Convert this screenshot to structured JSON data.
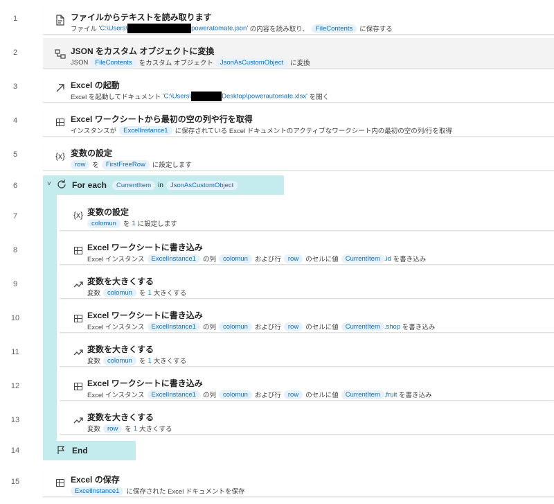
{
  "line_numbers": [
    "1",
    "2",
    "3",
    "4",
    "5",
    "6",
    "7",
    "8",
    "9",
    "10",
    "11",
    "12",
    "13",
    "14",
    "15"
  ],
  "steps": {
    "s1": {
      "icon": "file-read-icon",
      "title": "ファイルからテキストを読み取ります",
      "prefix": "ファイル",
      "path_start": "'C:\\Users\\",
      "path_end": "poweratomate.json'",
      "middle": "の内容を読み取り、",
      "var": "FileContents",
      "suffix": "に保存する"
    },
    "s2": {
      "icon": "convert-icon",
      "title": "JSON をカスタム オブジェクトに変換",
      "prefix": "JSON",
      "var1": "FileContents",
      "middle": "をカスタム オブジェクト",
      "var2": "JsonAsCustomObject",
      "suffix": "に変換"
    },
    "s3": {
      "icon": "launch-arrow-icon",
      "title": "Excel の起動",
      "prefix": "Excel を起動してドキュメント",
      "path_start": "'C:\\Users\\",
      "path_end": "Desktop\\powerautomate.xlsx'",
      "suffix": "を開く"
    },
    "s4": {
      "icon": "excel-icon",
      "title": "Excel ワークシートから最初の空の列や行を取得",
      "prefix": "インスタンスが",
      "var": "ExcelInstance1",
      "suffix": "に保存されている Excel ドキュメントのアクティブなワークシート内の最初の空の列/行を取得"
    },
    "s5": {
      "icon": "variable-icon",
      "icon_text": "{x}",
      "title": "変数の設定",
      "var1": "row",
      "middle": "を",
      "var2": "FirstFreeRow",
      "suffix": "に設定します"
    },
    "loop": {
      "chevron": "˅",
      "icon": "loop-icon",
      "title": "For each",
      "var1": "CurrentItem",
      "middle": "in",
      "var2": "JsonAsCustomObject"
    },
    "s7": {
      "icon_text": "{x}",
      "title": "変数の設定",
      "var": "colomun",
      "middle": "を",
      "num": "1",
      "suffix": "に設定します"
    },
    "s8": {
      "title": "Excel ワークシートに書き込み",
      "prefix": "Excel インスタンス",
      "var1": "ExcelInstance1",
      "t1": "の列",
      "var2": "colomun",
      "t2": "および行",
      "var3": "row",
      "t3": "のセルに値",
      "var4": "CurrentItem",
      "prop": ".id",
      "suffix": "を書き込み"
    },
    "s9": {
      "title": "変数を大きくする",
      "prefix": "変数",
      "var": "colomun",
      "middle": "を",
      "num": "1",
      "suffix": "大きくする"
    },
    "s10": {
      "title": "Excel ワークシートに書き込み",
      "prefix": "Excel インスタンス",
      "var1": "ExcelInstance1",
      "t1": "の列",
      "var2": "colomun",
      "t2": "および行",
      "var3": "row",
      "t3": "のセルに値",
      "var4": "CurrentItem",
      "prop": ".shop",
      "suffix": "を書き込み"
    },
    "s11": {
      "title": "変数を大きくする",
      "prefix": "変数",
      "var": "colomun",
      "middle": "を",
      "num": "1",
      "suffix": "大きくする"
    },
    "s12": {
      "title": "Excel ワークシートに書き込み",
      "prefix": "Excel インスタンス",
      "var1": "ExcelInstance1",
      "t1": "の列",
      "var2": "colomun",
      "t2": "および行",
      "var3": "row",
      "t3": "のセルに値",
      "var4": "CurrentItem",
      "prop": ".fruit",
      "suffix": "を書き込み"
    },
    "s13": {
      "title": "変数を大きくする",
      "prefix": "変数",
      "var": "row",
      "middle": "を",
      "num": "1",
      "suffix": "大きくする"
    },
    "end": {
      "icon": "flag-icon",
      "title": "End"
    },
    "s15": {
      "title": "Excel の保存",
      "var": "ExcelInstance1",
      "suffix": "に保存された Excel ドキュメントを保存"
    }
  },
  "colors": {
    "accent": "#0f6cbd",
    "chip_bg": "#e5f1fb",
    "loop_bg": "#c4ecef",
    "selected_bg": "#f3f3f3"
  }
}
